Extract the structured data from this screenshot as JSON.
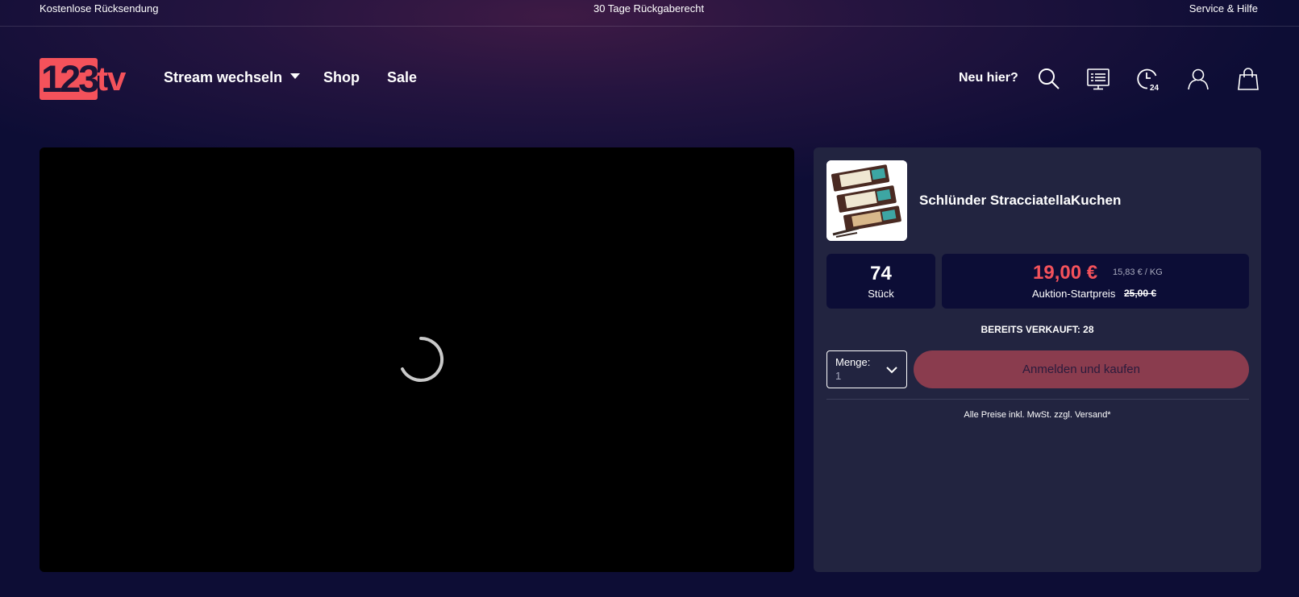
{
  "topbar": {
    "left": "Kostenlose Rücksendung",
    "center": "30 Tage Rückgaberecht",
    "right": "Service & Hilfe"
  },
  "logo": {
    "number": "123",
    "suffix": "tv"
  },
  "nav": {
    "stream": "Stream wechseln",
    "shop": "Shop",
    "sale": "Sale"
  },
  "header": {
    "new_here": "Neu hier?",
    "icons": [
      "search-icon",
      "tv-guide-icon",
      "clock-24-icon",
      "user-icon",
      "shopping-bag-icon"
    ],
    "clock_badge": "24"
  },
  "video": {
    "state": "loading"
  },
  "product": {
    "title": "Schlünder StracciatellaKuchen",
    "quantity": "74",
    "quantity_unit": "Stück",
    "price": "19,00 €",
    "unit_price": "15,83 € / KG",
    "start_price_label": "Auktion-Startpreis",
    "start_price": "25,00 €",
    "sold": "BEREITS VERKAUFT: 28",
    "qty_select_label": "Menge:",
    "qty_select_value": "1",
    "buy_label": "Anmelden und kaufen",
    "price_note": "Alle Preise inkl. MwSt. zzgl. Versand*"
  },
  "colors": {
    "accent": "#f4525b",
    "panel": "#222440",
    "box": "#0c0d36",
    "button": "#8a3c4e"
  }
}
